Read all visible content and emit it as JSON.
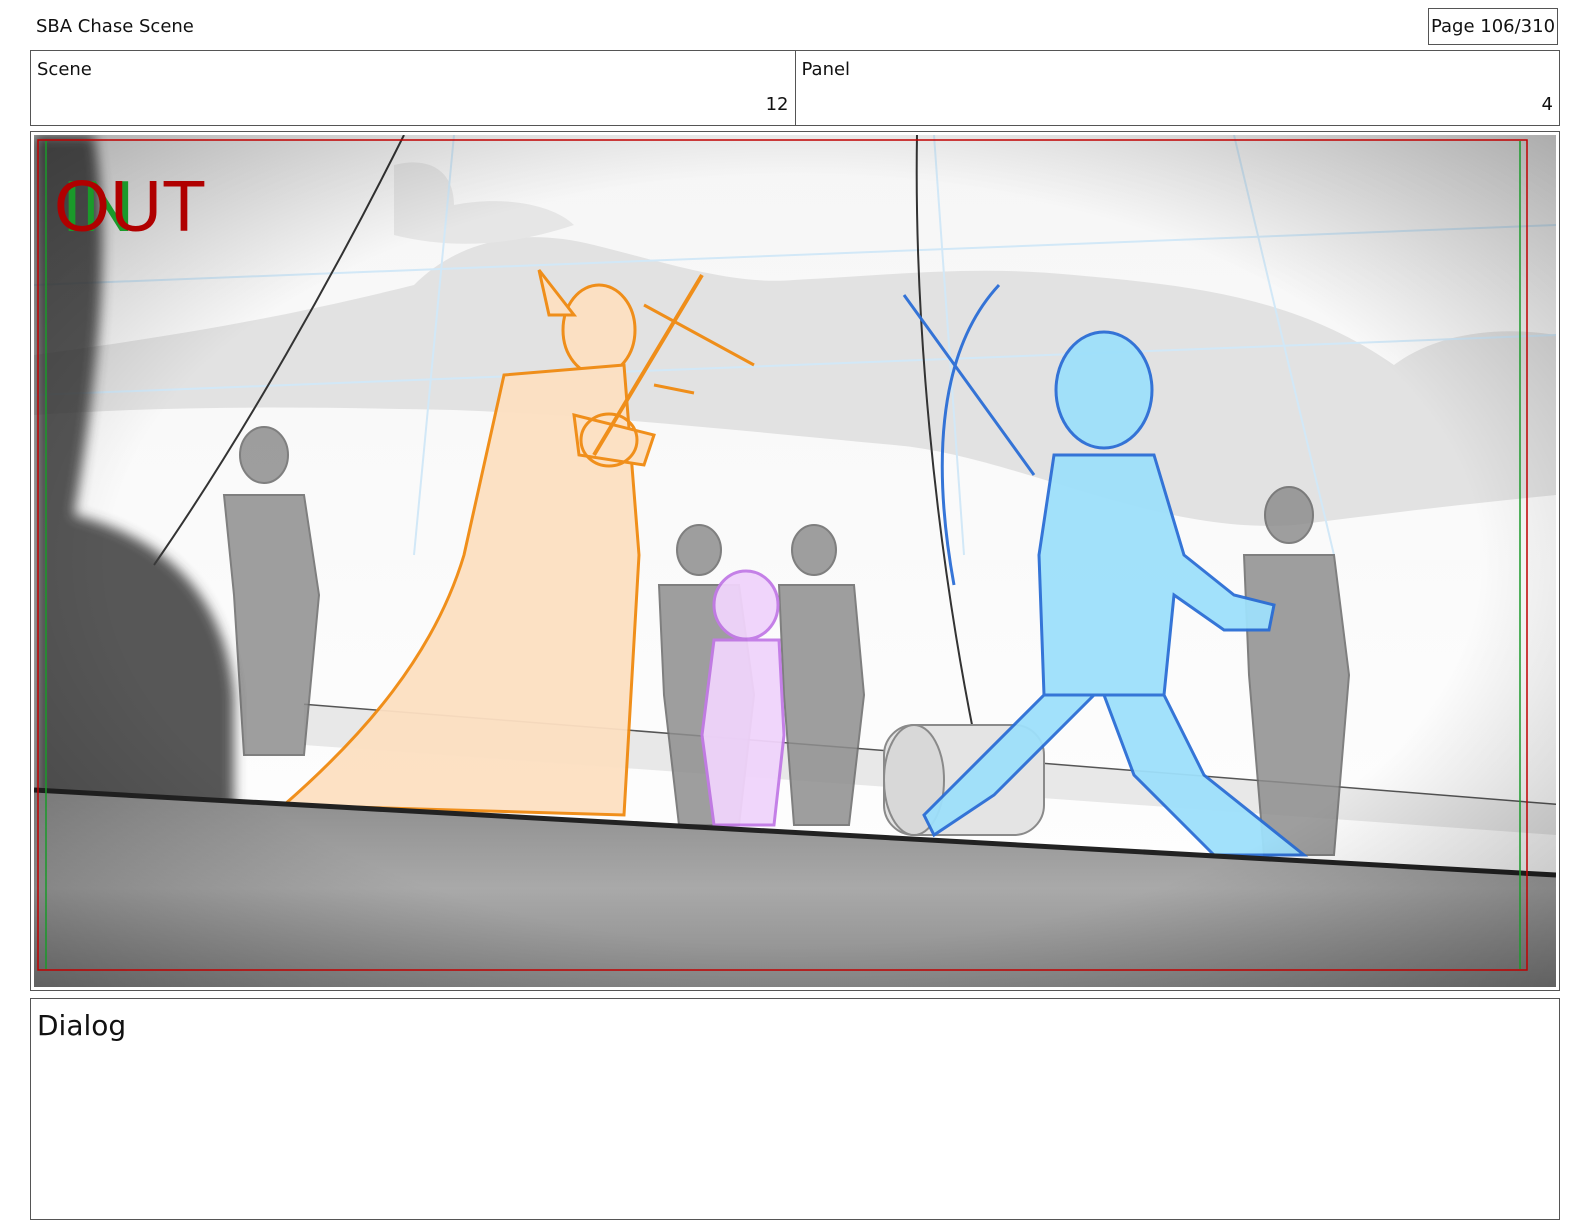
{
  "header": {
    "project_title": "SBA Chase Scene",
    "page_counter": "Page 106/310"
  },
  "info": {
    "scene_label": "Scene",
    "scene_value": "12",
    "panel_label": "Panel",
    "panel_value": "4"
  },
  "frame": {
    "in_marker": "IN",
    "out_marker": "OUT",
    "colors": {
      "in_marker": "#1a9a2a",
      "out_marker": "#b00000",
      "safe_frame": "#c00000",
      "orange_character": "#f08a10",
      "orange_fill": "#fde0c2",
      "blue_character": "#2b6ed6",
      "blue_fill": "#9ee0fb",
      "purple_character": "#c27ae6",
      "purple_fill": "#f0d4fb",
      "background_figures": "#8a8a8a"
    }
  },
  "dialog": {
    "label": "Dialog"
  }
}
